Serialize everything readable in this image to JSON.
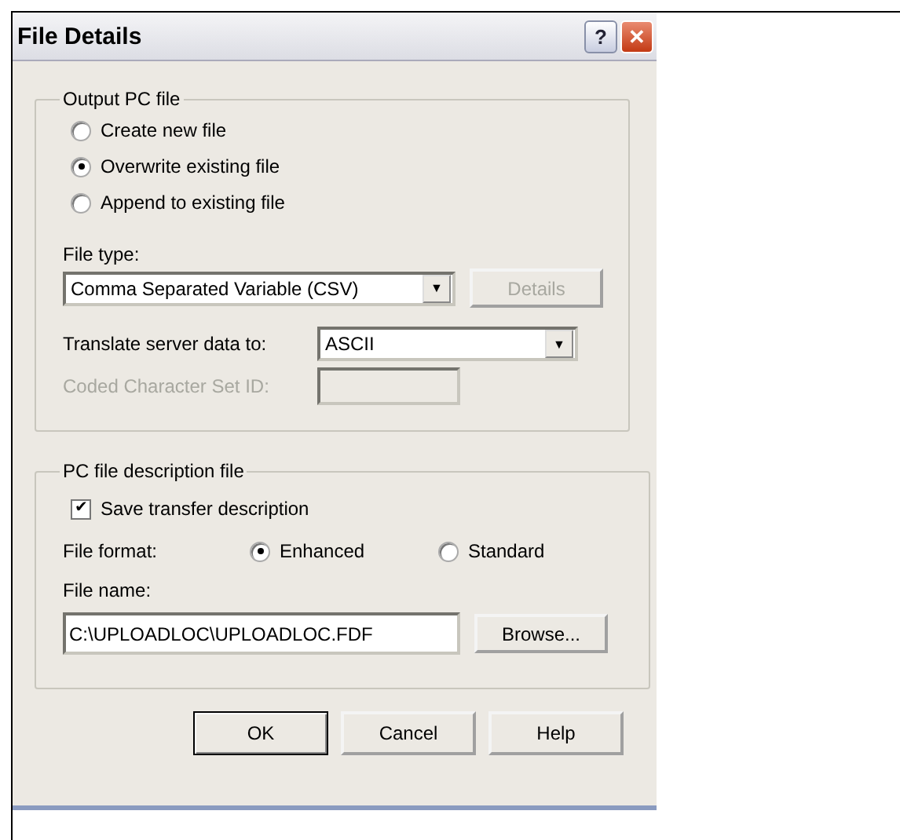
{
  "window": {
    "title": "File Details",
    "help_glyph": "?",
    "close_glyph": "✕"
  },
  "output_group": {
    "legend": "Output PC file",
    "options": [
      {
        "label": "Create new file",
        "selected": false
      },
      {
        "label": "Overwrite existing file",
        "selected": true
      },
      {
        "label": "Append to existing file",
        "selected": false
      }
    ],
    "file_type": {
      "label": "File type:",
      "value": "Comma Separated Variable (CSV)",
      "caret": "▼"
    },
    "details_button": {
      "label": "Details",
      "disabled": true
    },
    "translate": {
      "label": "Translate server data to:",
      "value": "ASCII",
      "caret": "▼"
    },
    "ccsid": {
      "label": "Coded Character Set ID:",
      "disabled": true
    }
  },
  "description_group": {
    "legend": "PC file description file",
    "save_transfer": {
      "label": "Save transfer description",
      "checked": true,
      "tick": "✔"
    },
    "format_label": "File format:",
    "formats": [
      {
        "label": "Enhanced",
        "selected": true
      },
      {
        "label": "Standard",
        "selected": false
      }
    ],
    "file_name": {
      "label": "File name:",
      "value": "C:\\UPLOADLOC\\UPLOADLOC.FDF"
    },
    "browse_button": "Browse..."
  },
  "buttons": [
    {
      "label": "OK",
      "default": true
    },
    {
      "label": "Cancel",
      "default": false
    },
    {
      "label": "Help",
      "default": false
    }
  ]
}
